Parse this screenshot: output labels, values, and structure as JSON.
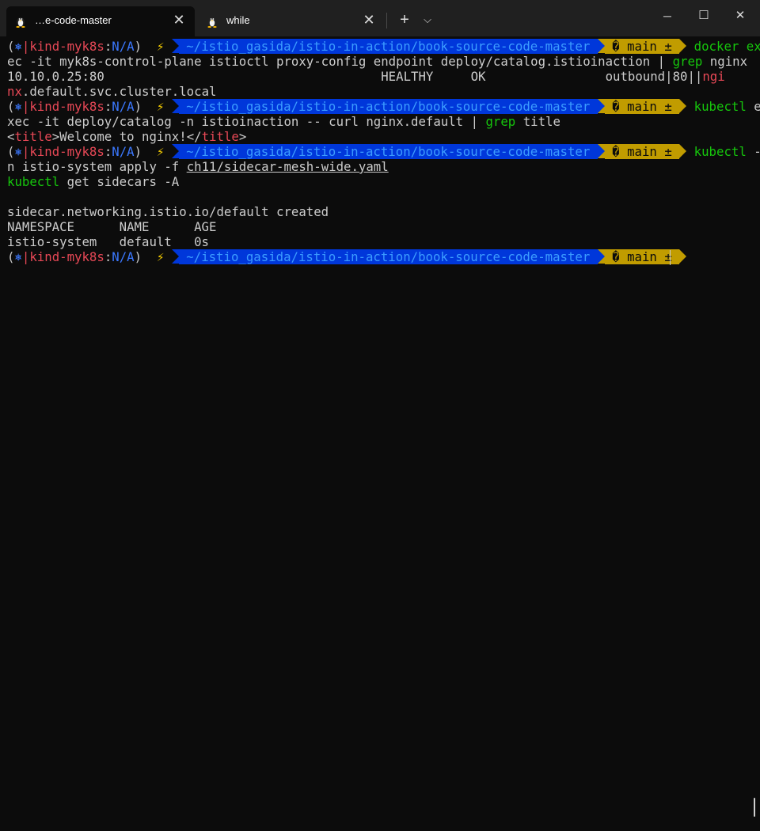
{
  "tabs": [
    {
      "title": "…e-code-master",
      "icon": "linux-tux-icon",
      "close": "✕"
    },
    {
      "title": "while",
      "icon": "linux-tux-icon",
      "close": "✕"
    }
  ],
  "tabbar": {
    "new_tab": "+",
    "dropdown": "⌵"
  },
  "window": {
    "minimize": "─",
    "maximize": "☐",
    "close": "✕"
  },
  "prompt": {
    "open_paren": "(",
    "k8s_icon": "⎈",
    "bar": "|",
    "context": "kind-myk8s",
    "colon": ":",
    "namespace": "N/A",
    "close_paren": ")",
    "bolt": "⚡",
    "path": " ~/istio_gasida/istio-in-action/book-source-code-master ",
    "branch": " � main ± "
  },
  "lines": {
    "l1_cmd": "docker ex",
    "l2_text": "ec -it myk8s-control-plane istioctl proxy-config endpoint deploy/catalog.istioinaction | ",
    "l2_grep": "grep",
    "l2_tail": " nginx",
    "l3_text": "10.10.0.25:80                                     HEALTHY     OK                outbound|80||",
    "l3_ngi": "ngi",
    "l4_nx": "nx",
    "l4_text": ".default.svc.cluster.local",
    "l5_cmd": "kubectl",
    "l5_tail": " e",
    "l6_text": "xec -it deploy/catalog -n istioinaction -- curl nginx.default | ",
    "l6_grep": "grep",
    "l6_tail": " title",
    "l7_lt1": "<",
    "l7_title1": "title",
    "l7_mid": ">Welcome to nginx!</",
    "l7_title2": "title",
    "l7_gt": ">",
    "l8_cmd": "kubectl",
    "l8_tail": " -",
    "l9_text": "n istio-system apply -f ",
    "l9_file": "ch11/sidecar-mesh-wide.yaml",
    "l10_cmd": "kubectl",
    "l10_tail": " get sidecars -A",
    "l12_text": "sidecar.networking.istio.io/default created",
    "l13_text": "NAMESPACE      NAME      AGE",
    "l14_text": "istio-system   default   0s"
  },
  "colors": {
    "background": "#0c0c0c",
    "prompt_path_bg": "#0037da",
    "prompt_branch_bg": "#c19c00",
    "command_green": "#16c60c",
    "match_red": "#e74856",
    "context_red": "#e74856",
    "namespace_blue": "#3b78ff"
  }
}
